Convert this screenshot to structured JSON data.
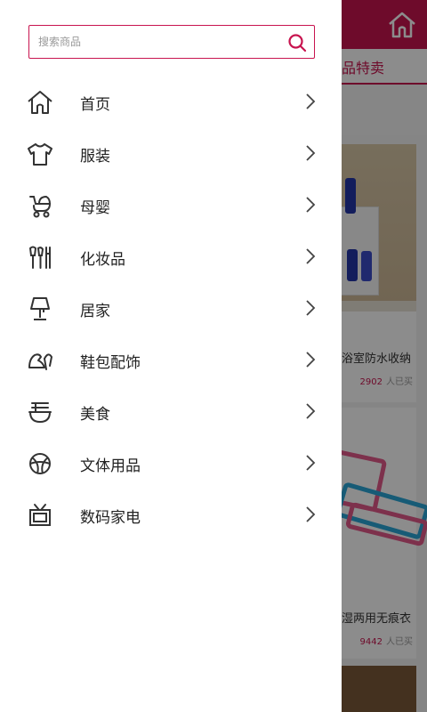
{
  "background": {
    "tab_label": "品特卖",
    "cards": [
      {
        "caption": "浴室防水收纳",
        "sold_count": "2902",
        "sold_suffix": "人已买"
      },
      {
        "caption": "湿两用无痕衣",
        "sold_count": "9442",
        "sold_suffix": "人已买"
      }
    ]
  },
  "drawer": {
    "search": {
      "placeholder": "搜索商品",
      "value": ""
    },
    "menu": [
      {
        "label": "首页",
        "icon": "home-icon"
      },
      {
        "label": "服装",
        "icon": "tshirt-icon"
      },
      {
        "label": "母婴",
        "icon": "stroller-icon"
      },
      {
        "label": "化妆品",
        "icon": "makeup-brushes-icon"
      },
      {
        "label": "居家",
        "icon": "lamp-icon"
      },
      {
        "label": "鞋包配饰",
        "icon": "shoe-icon"
      },
      {
        "label": "美食",
        "icon": "noodle-bowl-icon"
      },
      {
        "label": "文体用品",
        "icon": "ball-icon"
      },
      {
        "label": "数码家电",
        "icon": "tv-icon"
      }
    ]
  },
  "colors": {
    "accent": "#c8144f",
    "text": "#222222",
    "icon": "#333333"
  }
}
